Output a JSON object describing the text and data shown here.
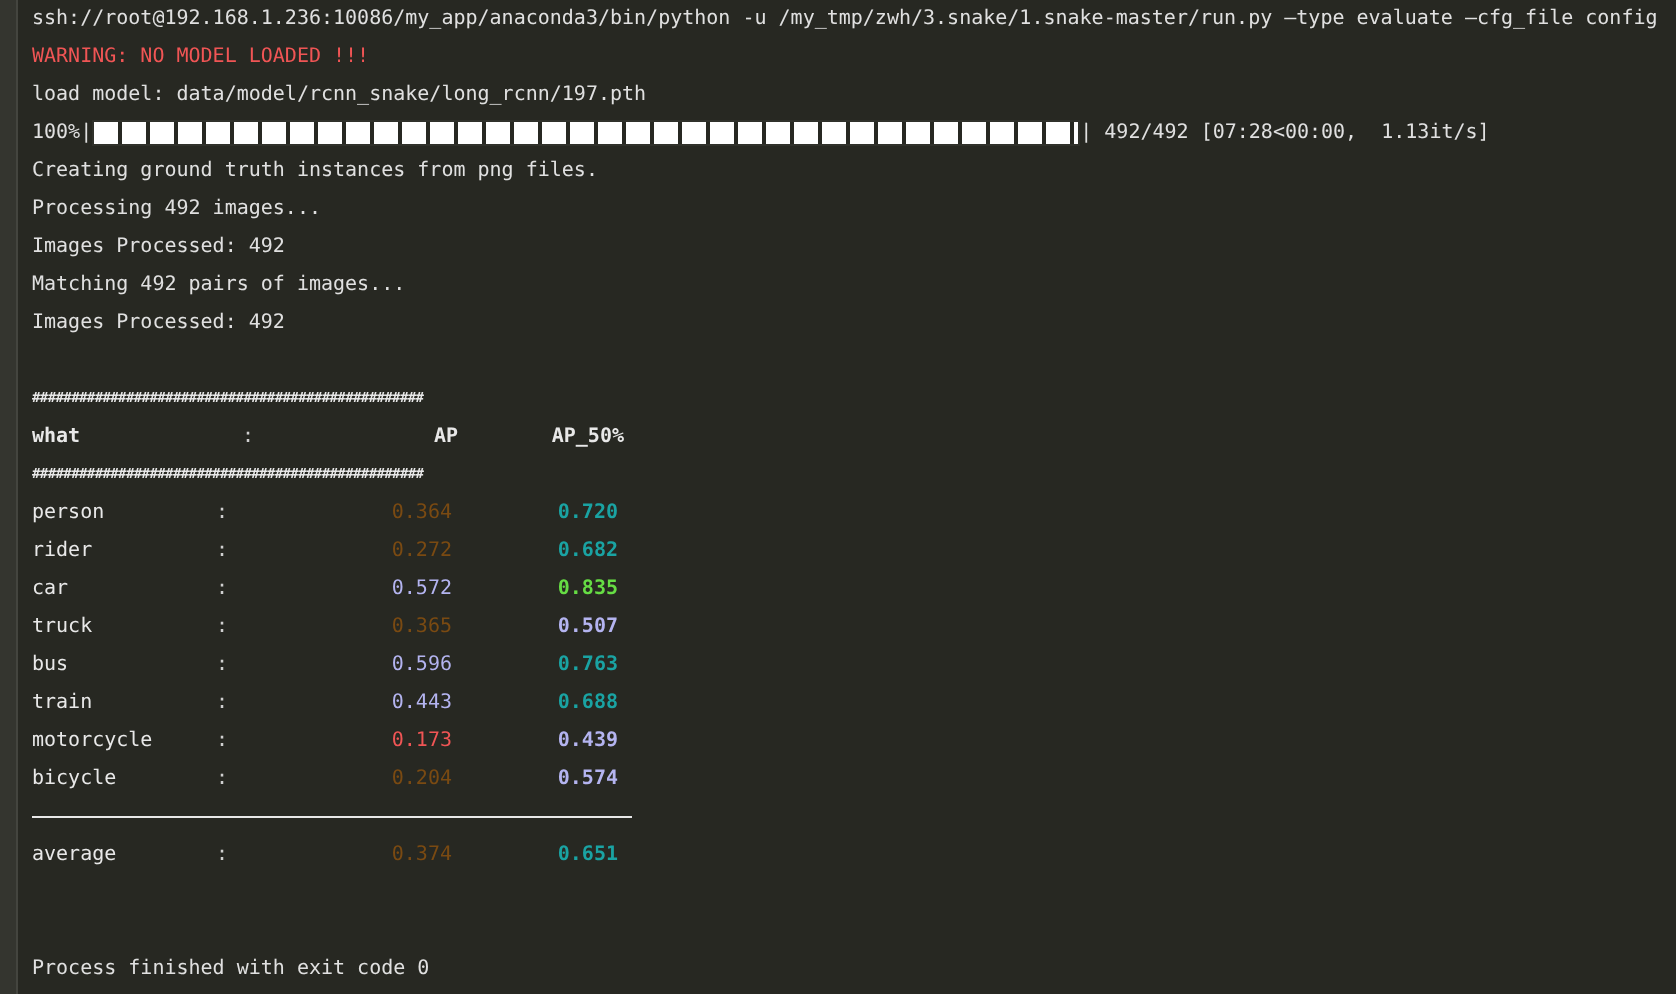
{
  "console": {
    "command": "ssh://root@192.168.1.236:10086/my_app/anaconda3/bin/python -u /my_tmp/zwh/3.snake/1.snake-master/run.py —type evaluate —cfg_file config",
    "warning": "WARNING: NO MODEL LOADED !!!",
    "load_line": "load model: data/model/rcnn_snake/long_rcnn/197.pth",
    "progress": {
      "percent": "100%|",
      "level": 1,
      "stats": "| 492/492 [07:28<00:00,  1.13it/s]"
    },
    "log_lines": [
      "Creating ground truth instances from png files.",
      "Processing 492 images...",
      "Images Processed: 492",
      "Matching 492 pairs of images...",
      "Images Processed: 492"
    ],
    "table": {
      "separator": "##################################################",
      "header": {
        "name": "what",
        "colon": ":",
        "ap": {
          "text": "AP"
        },
        "ap50": {
          "text": "AP_50%"
        }
      },
      "rows": [
        {
          "name": "person",
          "colon": ":",
          "ap": {
            "text": "0.364",
            "color": "#7a4a12"
          },
          "ap50": {
            "text": "0.720",
            "color": "#1aa3a3"
          }
        },
        {
          "name": "rider",
          "colon": ":",
          "ap": {
            "text": "0.272",
            "color": "#7a4a12"
          },
          "ap50": {
            "text": "0.682",
            "color": "#1aa3a3"
          }
        },
        {
          "name": "car",
          "colon": ":",
          "ap": {
            "text": "0.572",
            "color": "#b4b4f0"
          },
          "ap50": {
            "text": "0.835",
            "color": "#66dd44"
          }
        },
        {
          "name": "truck",
          "colon": ":",
          "ap": {
            "text": "0.365",
            "color": "#7a4a12"
          },
          "ap50": {
            "text": "0.507",
            "color": "#b4b4f0"
          }
        },
        {
          "name": "bus",
          "colon": ":",
          "ap": {
            "text": "0.596",
            "color": "#b4b4f0"
          },
          "ap50": {
            "text": "0.763",
            "color": "#1aa3a3"
          }
        },
        {
          "name": "train",
          "colon": ":",
          "ap": {
            "text": "0.443",
            "color": "#b4b4f0"
          },
          "ap50": {
            "text": "0.688",
            "color": "#1aa3a3"
          }
        },
        {
          "name": "motorcycle",
          "colon": ":",
          "ap": {
            "text": "0.173",
            "color": "#f05555"
          },
          "ap50": {
            "text": "0.439",
            "color": "#b4b4f0"
          }
        },
        {
          "name": "bicycle",
          "colon": ":",
          "ap": {
            "text": "0.204",
            "color": "#7a4a12"
          },
          "ap50": {
            "text": "0.574",
            "color": "#b4b4f0"
          }
        }
      ],
      "average": {
        "name": "average",
        "colon": ":",
        "ap": {
          "text": "0.374",
          "color": "#7a4a12"
        },
        "ap50": {
          "text": "0.651",
          "color": "#1aa3a3"
        }
      }
    },
    "exit_line": "Process finished with exit code 0"
  }
}
